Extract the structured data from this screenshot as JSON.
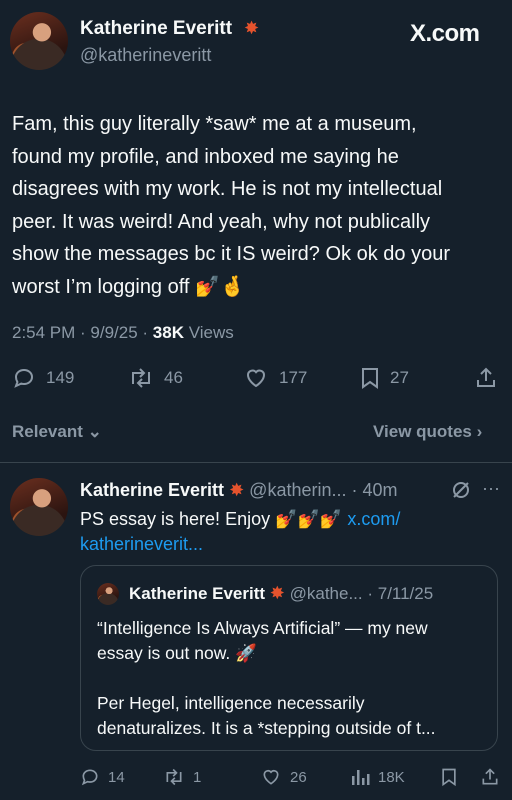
{
  "header": {
    "name": "Katherine Everitt",
    "handle": "@katherineveritt",
    "brand": "X.com",
    "star_glyph": "✸"
  },
  "post": {
    "lines": [
      "Fam, this guy literally *saw* me at a museum,",
      "found my profile, and inboxed me saying he",
      "disagrees with my work. He is not my intellectual",
      "peer. It was weird! And yeah, why not publically",
      "show the messages bc it IS weird? Ok ok do your",
      "worst I’m logging off"
    ],
    "emoji": "💅🤞",
    "time": "2:54 PM",
    "date": "9/9/25",
    "views_count": "38K",
    "views_label": "Views",
    "replies": "149",
    "reposts": "46",
    "likes": "177",
    "bookmarks": "27"
  },
  "sort": {
    "relevant": "Relevant",
    "view_quotes": "View quotes"
  },
  "reply": {
    "name": "Katherine Everitt",
    "handle": "@katherin...",
    "age": "40m",
    "text_main": "PS essay is here! Enjoy",
    "emoji": "💅💅💅",
    "link_part1": "x.com/",
    "link_part2": "katherineverit...",
    "quote": {
      "name": "Katherine Everitt",
      "handle": "@kathe...",
      "date": "7/11/25",
      "lines": [
        "“Intelligence Is Always Artificial” — my new",
        "essay is out now."
      ],
      "emoji": "🚀",
      "lines2": [
        "Per Hegel, intelligence necessarily",
        "denaturalizes. It is a *stepping outside of t..."
      ]
    },
    "replies": "14",
    "reposts": "1",
    "likes": "26",
    "views": "18K"
  },
  "colors": {
    "background": "#15202b",
    "text": "#f7f9f9",
    "muted": "#8b98a5",
    "link": "#1d9bf0",
    "divider": "#38444d"
  }
}
